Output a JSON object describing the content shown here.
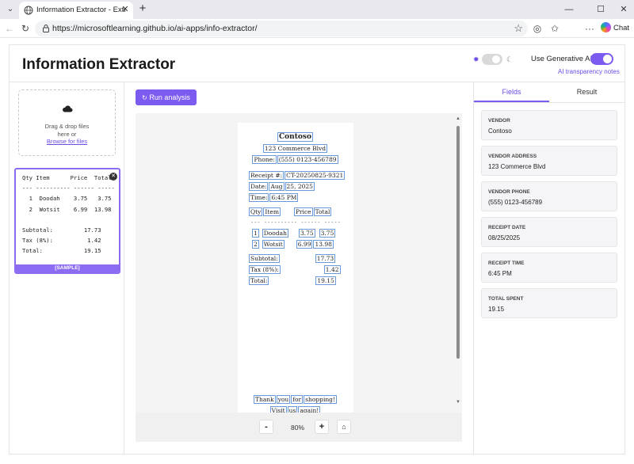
{
  "browser": {
    "tab_title": "Information Extractor - Extract data",
    "url": "https://microsoftlearning.github.io/ai-apps/info-extractor/",
    "chat_label": "Chat"
  },
  "app": {
    "title": "Information Extractor",
    "generative_ai_label": "Use Generative AI",
    "generative_ai_enabled": true,
    "dark_mode_enabled": false,
    "ai_notes_link": "AI transparency notes",
    "accent_color": "#7b5bf0"
  },
  "upload": {
    "drag_drop_text": "Drag & drop files here or",
    "browse_link": "Browse for files",
    "sample_badge": "[SAMPLE]",
    "thumbnail_lines": [
      "Qty Item      Price  Total",
      "--- ---------- ------ -----",
      "  1  Doodah    3.75   3.75",
      "  2  Wotsit    6.99  13.98",
      "",
      "Subtotal:         17.73",
      "Tax (8%):          1.42",
      "Total:            19.15"
    ]
  },
  "analysis": {
    "run_button": "Run analysis",
    "zoom_minus": "-",
    "zoom_level": "80%",
    "zoom_plus": "+",
    "zoom_reset_icon": "house-icon"
  },
  "receipt": {
    "store": "Contoso",
    "address": "123 Commerce Blvd",
    "phone_label": "Phone:",
    "phone": "(555) 0123-456789",
    "receipt_label": "Receipt #:",
    "receipt_no": "CT-20250825-9321",
    "date_label": "Date:",
    "date_month": "Aug",
    "date_rest": "25, 2025",
    "time_label": "Time:",
    "time": "6:45 PM",
    "col_qty": "Qty",
    "col_item": "Item",
    "col_price": "Price",
    "col_total": "Total",
    "divider": "--- ---------- ------ -----",
    "rows": [
      {
        "qty": "1",
        "item": "Doodah",
        "price": "3.75",
        "total": "3.75"
      },
      {
        "qty": "2",
        "item": "Wotsit",
        "price": "6.99",
        "total": "13.98"
      }
    ],
    "subtotal_label": "Subtotal:",
    "subtotal": "17.73",
    "tax_label": "Tax (8%):",
    "tax": "1.42",
    "total_label": "Total:",
    "total": "19.15",
    "thanks_words": [
      "Thank",
      "you",
      "for",
      "shopping!"
    ],
    "visit_words": [
      "Visit",
      "us",
      "again!"
    ]
  },
  "results": {
    "tabs": [
      "Fields",
      "Result"
    ],
    "active_tab": "Fields",
    "fields": [
      {
        "label": "VENDOR",
        "value": "Contoso"
      },
      {
        "label": "VENDOR ADDRESS",
        "value": "123 Commerce Blvd"
      },
      {
        "label": "VENDOR PHONE",
        "value": "(555) 0123-456789"
      },
      {
        "label": "RECEIPT DATE",
        "value": "08/25/2025"
      },
      {
        "label": "RECEIPT TIME",
        "value": "6:45 PM"
      },
      {
        "label": "TOTAL SPENT",
        "value": "19.15"
      }
    ]
  }
}
